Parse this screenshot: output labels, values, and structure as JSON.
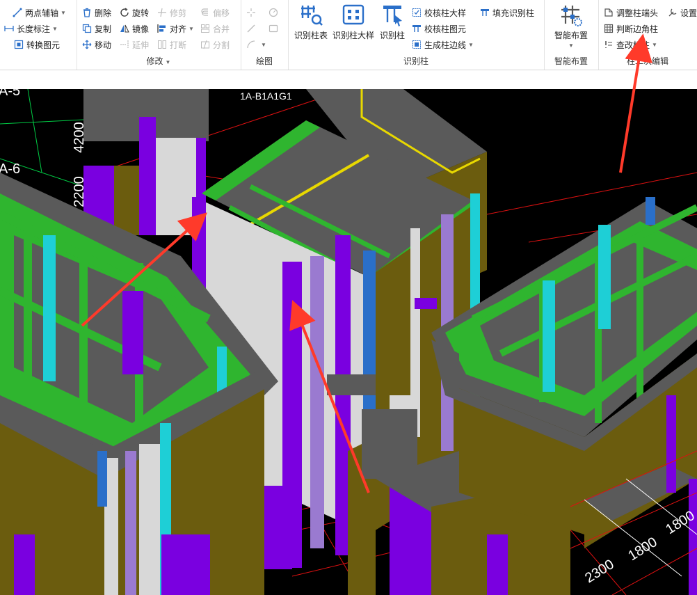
{
  "ribbon": {
    "col1": {
      "btn1": "两点辅轴",
      "btn2": "长度标注",
      "btn3": "转换图元"
    },
    "modify": {
      "title": "修改",
      "delete": "删除",
      "rotate": "旋转",
      "trim": "修剪",
      "offset": "偏移",
      "copy": "复制",
      "mirror": "镜像",
      "align": "对齐",
      "merge": "合并",
      "move": "移动",
      "extend": "延伸",
      "break": "打断",
      "split": "分割"
    },
    "draw": {
      "title": "绘图"
    },
    "identify": {
      "title": "识别柱",
      "table": "识别柱表",
      "detail": "识别柱大样",
      "column": "识别柱",
      "check_detail": "校核柱大样",
      "check_element": "校核柱图元",
      "gen_edge": "生成柱边线",
      "fill": "填充识别柱"
    },
    "smart": {
      "title": "智能布置",
      "btn": "智能布置"
    },
    "edit2": {
      "title": "柱二次编辑",
      "adjust_head": "调整柱端头",
      "settings": "设置",
      "judge_corner": "判断边角柱",
      "check_change": "查改标注"
    }
  },
  "viewport": {
    "axis_labels": [
      "A-5",
      "A-6"
    ],
    "dim_labels": [
      "4200",
      "2200",
      "2300",
      "1800",
      "1800"
    ],
    "top_text": "1A-B1A1G1"
  },
  "colors": {
    "annotation_arrow": "#ff3a2a",
    "accent_blue": "#2a6fc9"
  }
}
